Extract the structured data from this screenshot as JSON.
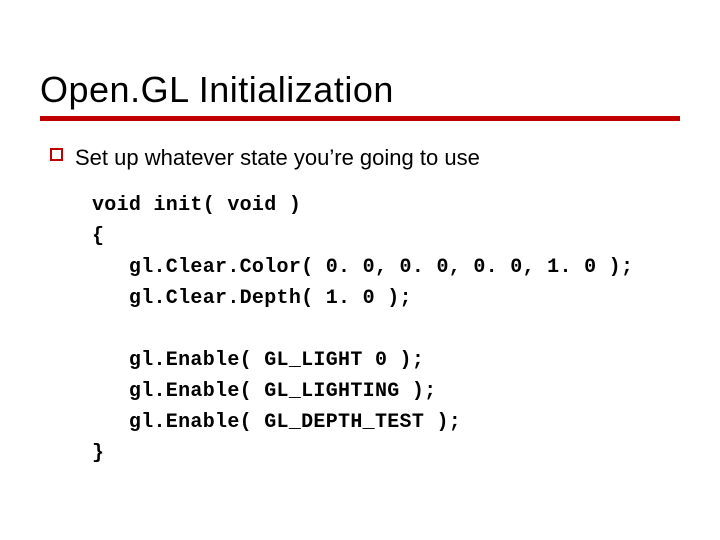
{
  "title": "Open.GL Initialization",
  "bullet": "Set up whatever state you’re going to use",
  "code": "void init( void )\n{\n   gl.Clear.Color( 0. 0, 0. 0, 0. 0, 1. 0 );\n   gl.Clear.Depth( 1. 0 );\n\n   gl.Enable( GL_LIGHT 0 );\n   gl.Enable( GL_LIGHTING );\n   gl.Enable( GL_DEPTH_TEST );\n}"
}
